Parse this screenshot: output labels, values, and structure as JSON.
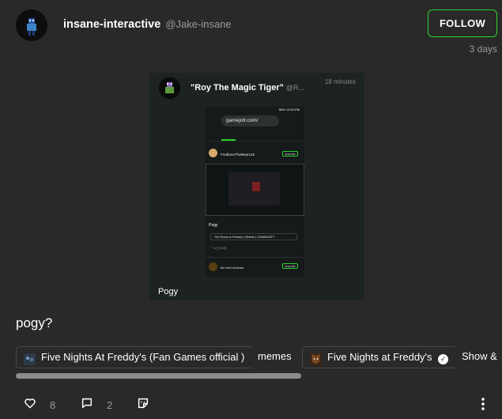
{
  "post": {
    "author_name": "insane-interactive",
    "author_handle": "@Jake-insane",
    "follow_label": "FOLLOW",
    "time_ago": "3 days",
    "text": "pogy?",
    "like_count": "8",
    "comment_count": "2"
  },
  "embedded_screenshot": {
    "title": "\"Roy The Magic Tiger\"",
    "handle": "@R...",
    "time": "18 minutes",
    "caption": "Pogy",
    "phone": {
      "status": "56% 12:43 PM",
      "url": "gamejolt.com/",
      "user": "FredbearTheBear125",
      "follow_label": "FOLLOW",
      "post_text": "Pogy",
      "tag": "The Return to Freddy's | Rebirth | COMMUNITY",
      "icons_row": "♡ 1   ▢ 1   ◫",
      "second_user": "the fred of bears",
      "second_follow": "FOLLOW"
    }
  },
  "tags": [
    {
      "label": "Five Nights At Freddy's (Fan Games official )",
      "icon": "fnaf-fangames-icon"
    },
    {
      "label": "memes",
      "icon": ""
    },
    {
      "label": "Five Nights at Freddy's",
      "icon": "freddy-icon",
      "verified": true
    },
    {
      "label": "Show &",
      "icon": ""
    }
  ],
  "colors": {
    "background": "#292929",
    "accent_green": "#2bd32b",
    "muted_text": "#9a9a9a"
  }
}
